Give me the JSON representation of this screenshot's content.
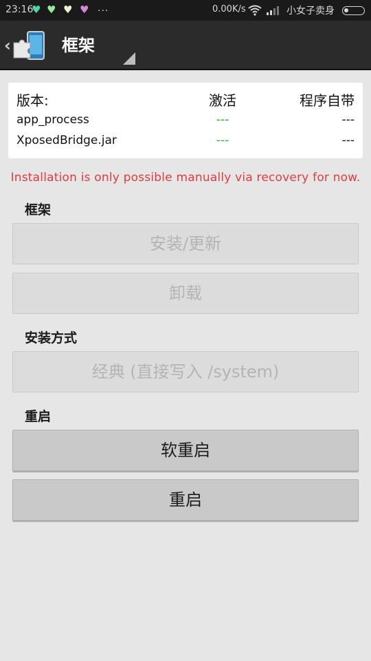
{
  "status_bar": {
    "time": "23:16",
    "notifications": [
      "heart-icon",
      "heart-icon",
      "heart-icon",
      "heart-icon"
    ],
    "more": "...",
    "net_speed": "0.00K/s",
    "carrier": "小女子卖身"
  },
  "action_bar": {
    "title": "框架"
  },
  "version_table": {
    "headers": [
      "版本:",
      "激活",
      "程序自带"
    ],
    "rows": [
      {
        "name": "app_process",
        "active": "---",
        "bundled": "---"
      },
      {
        "name": "XposedBridge.jar",
        "active": "---",
        "bundled": "---"
      }
    ]
  },
  "warning": "Installation is only possible manually via recovery for now.",
  "sections": {
    "framework": {
      "label": "框架",
      "install_update": "安装/更新",
      "uninstall": "卸载"
    },
    "install_method": {
      "label": "安装方式",
      "selected": "经典 (直接写入 /system)"
    },
    "reboot": {
      "label": "重启",
      "soft_reboot": "软重启",
      "reboot": "重启"
    }
  },
  "colors": {
    "active_dash": "#2eaa2e",
    "warning": "#e43b3b",
    "actionbar": "#2b2b2b"
  }
}
